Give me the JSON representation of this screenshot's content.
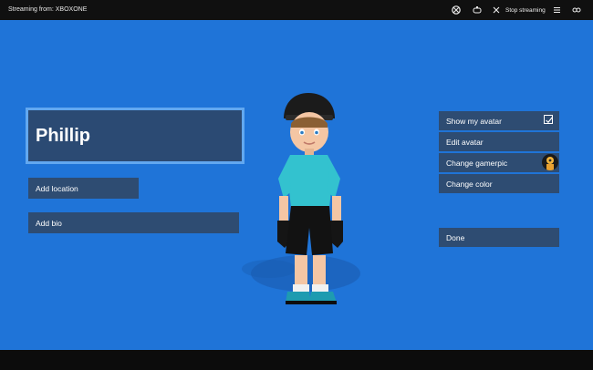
{
  "titlebar": {
    "title": "Streaming from: XBOXONE",
    "stop_label": "Stop streaming"
  },
  "profile": {
    "gamertag": "Phillip",
    "add_location_label": "Add location",
    "add_bio_label": "Add bio"
  },
  "menu": {
    "show_avatar_label": "Show my avatar",
    "show_avatar_checked": true,
    "edit_avatar_label": "Edit avatar",
    "change_gamerpic_label": "Change gamerpic",
    "change_color_label": "Change color",
    "done_label": "Done"
  },
  "colors": {
    "background": "#1f74d8",
    "panel": "#2e4c72",
    "focus_border": "#62a8f0"
  }
}
